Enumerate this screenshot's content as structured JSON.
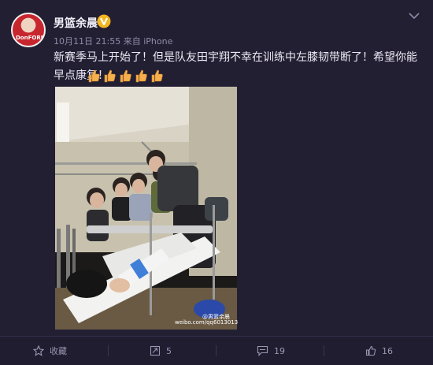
{
  "post": {
    "username": "男篮余晨",
    "time": "10月11日 21:55",
    "source_prefix": "来自",
    "source": "iPhone",
    "content": "新赛季马上开始了！但是队友田宇翔不幸在训练中左膝韧带断了！希望你能早点康复！",
    "thumb_count": 5,
    "avatar_text": "DonFORD",
    "photo_watermark_name": "@男篮余晨",
    "photo_watermark_url": "weibo.com/qq6013013",
    "photo_alt": "five young men posing beside a hospital bed, one with a bandaged leg"
  },
  "actions": {
    "favorite_label": "收藏",
    "repost_count": "5",
    "comment_count": "19",
    "like_count": "16"
  },
  "colors": {
    "background": "#231f33",
    "verified_badge": "#f3b61f",
    "thumb": "#f5b04d"
  }
}
